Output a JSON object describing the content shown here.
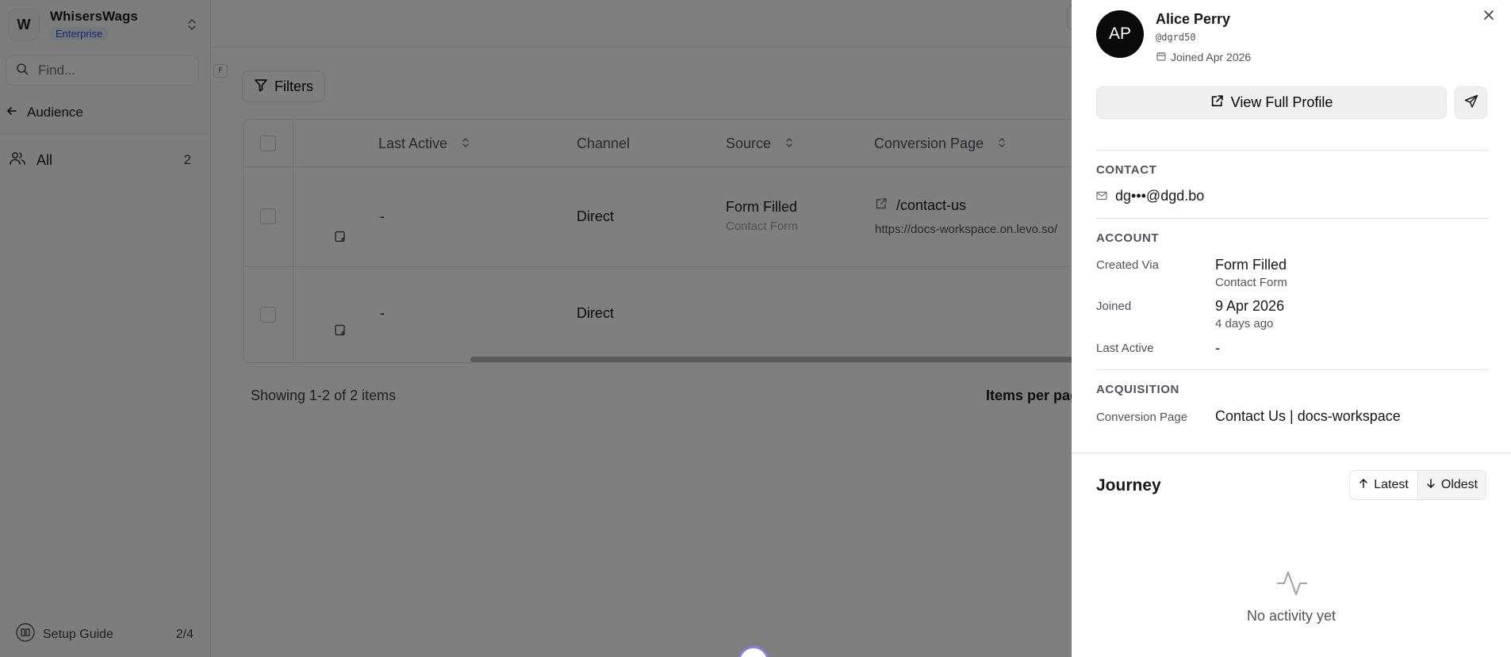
{
  "sidebar": {
    "workspace_initial": "W",
    "workspace_name": "WhisersWags",
    "plan_badge": "Enterprise",
    "search_placeholder": "Find...",
    "search_shortcut": "F",
    "back_label": "Audience",
    "nav": [
      {
        "label": "All",
        "count": "2",
        "icon": "users-icon"
      }
    ],
    "setup_label": "Setup Guide",
    "setup_progress": "2/4"
  },
  "toolbar": {
    "filters_label": "Filters"
  },
  "table": {
    "columns": [
      "Last Active",
      "Channel",
      "Source",
      "Conversion Page"
    ],
    "rows": [
      {
        "last_active": "-",
        "channel": "Direct",
        "source": "Form Filled",
        "source_sub": "Contact Form",
        "page_path": "/contact-us",
        "page_url": "https://docs-workspace.on.levo.so/"
      },
      {
        "last_active": "-",
        "channel": "Direct",
        "source": "",
        "source_sub": "",
        "page_path": "",
        "page_url": ""
      }
    ],
    "showing": "Showing 1-2 of 2 items",
    "items_per_page": "Items per page"
  },
  "drawer": {
    "initials": "AP",
    "name": "Alice Perry",
    "handle": "@dgrd50",
    "joined": "Joined Apr 2026",
    "view_profile": "View Full Profile",
    "contact": {
      "title": "CONTACT",
      "email": "dg•••@dgd.bo"
    },
    "account": {
      "title": "ACCOUNT",
      "created_via_label": "Created Via",
      "created_via": "Form Filled",
      "created_via_sub": "Contact Form",
      "joined_label": "Joined",
      "joined": "9 Apr 2026",
      "joined_sub": "4 days ago",
      "last_active_label": "Last Active",
      "last_active": "-"
    },
    "acquisition": {
      "title": "ACQUISITION",
      "conversion_label": "Conversion Page",
      "conversion_page": "Contact Us | docs-workspace"
    },
    "journey": {
      "title": "Journey",
      "latest": "Latest",
      "oldest": "Oldest",
      "empty": "No activity yet"
    }
  },
  "colors": {
    "overlay": "#000000",
    "badge_bg": "#e6eefc",
    "badge_text": "#2453c7",
    "avatar_bg": "#0a0a0a"
  }
}
